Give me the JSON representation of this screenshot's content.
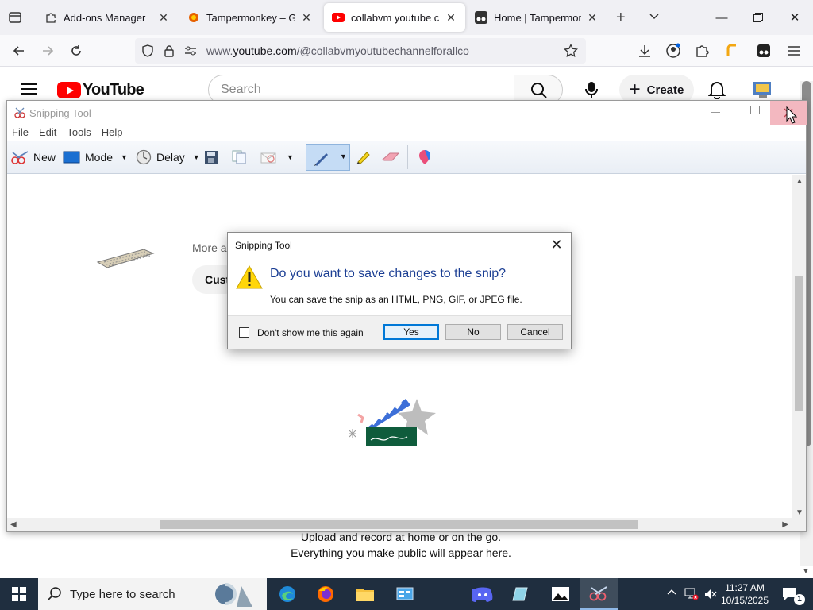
{
  "browser": {
    "tabs": [
      {
        "label": "Add-ons Manager"
      },
      {
        "label": "Tampermonkey – Get th"
      },
      {
        "label": "collabvm youtube chan"
      },
      {
        "label": "Home | Tampermonkey"
      }
    ],
    "url_prefix": "www.",
    "url_domain": "youtube.com",
    "url_path": "/@collabvmyoutubechannelforallco"
  },
  "youtube": {
    "logo_text": "YouTube",
    "search_placeholder": "Search",
    "create_label": "Create",
    "customize_label": "Cust",
    "more_text": "More a",
    "upload_msg": "Upload and record at home or on the go.",
    "public_msg": "Everything you make public will appear here."
  },
  "snipping_tool": {
    "title": "Snipping Tool",
    "menu": [
      "File",
      "Edit",
      "Tools",
      "Help"
    ],
    "toolbar": {
      "new_label": "New",
      "mode_label": "Mode",
      "delay_label": "Delay"
    }
  },
  "dialog": {
    "title": "Snipping Tool",
    "question": "Do you want to save changes to the snip?",
    "subtext": "You can save the snip as an HTML, PNG, GIF, or JPEG file.",
    "checkbox_label": "Don't show me this again",
    "yes_label": "Yes",
    "no_label": "No",
    "cancel_label": "Cancel"
  },
  "taskbar": {
    "search_placeholder": "Type here to search",
    "time": "11:27 AM",
    "date": "10/15/2025",
    "notification_count": "1"
  },
  "colors": {
    "youtube_red": "#ff0000",
    "dialog_question": "#1c3f94",
    "taskbar_bg": "#1f2e3f",
    "close_hover": "#f3b8c0"
  }
}
